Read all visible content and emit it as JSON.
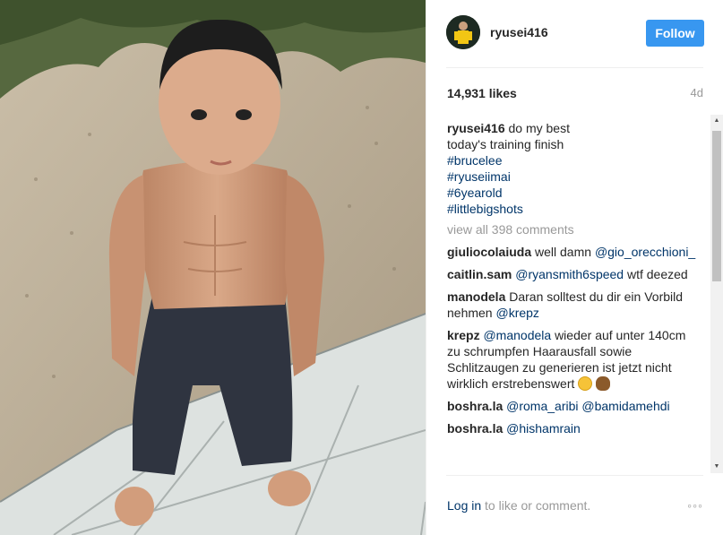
{
  "header": {
    "username": "ryusei416",
    "follow_label": "Follow",
    "avatar_icon": "profile-avatar"
  },
  "stats": {
    "likes": "14,931 likes",
    "age": "4d"
  },
  "caption": {
    "user": "ryusei416",
    "lines": [
      "do my best",
      "today's training finish"
    ],
    "hashtags": [
      "#brucelee",
      "#ryuseiimai",
      "#6yearold",
      "#littlebigshots"
    ]
  },
  "view_all": "view all 398 comments",
  "comments": [
    {
      "user": "giuliocolaiuda",
      "text": "well damn",
      "mentions": "@gio_orecchioni_"
    },
    {
      "user": "caitlin.sam",
      "mention": "@ryansmith6speed",
      "text": "wtf deezed"
    },
    {
      "user": "manodela",
      "text": "Daran solltest du dir ein Vorbild nehmen",
      "mention": "@krepz"
    },
    {
      "user": "krepz",
      "mention": "@manodela",
      "text": "wieder auf unter 140cm zu schrumpfen Haarausfall sowie Schlitzaugen zu generieren ist jetzt nicht wirklich erstrebenswert"
    },
    {
      "user": "boshra.la",
      "mention": "@roma_aribi @bamidamehdi"
    },
    {
      "user": "boshra.la",
      "mention": "@hishamrain"
    }
  ],
  "footer": {
    "login": "Log in",
    "rest": " to like or comment.",
    "more": "◦◦◦"
  },
  "colors": {
    "follow": "#3897f0",
    "link": "#003569",
    "muted": "#999999"
  }
}
